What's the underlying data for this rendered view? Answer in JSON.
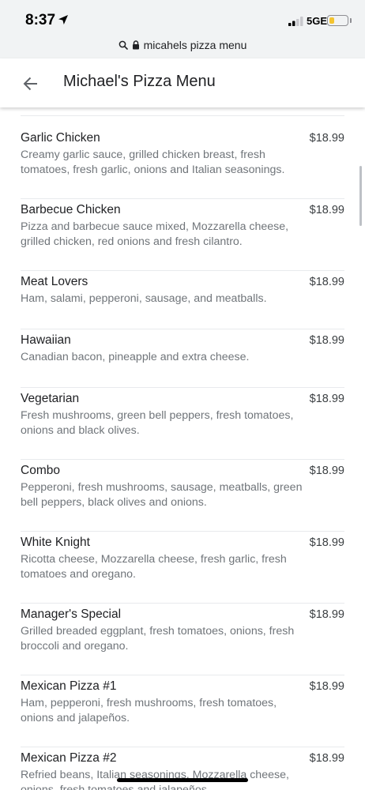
{
  "status_bar": {
    "time": "8:37",
    "network": "5GE",
    "battery_level": 0.3,
    "battery_color": "#f4c430"
  },
  "browser": {
    "url_text": "micahels pizza menu",
    "icons": [
      "search-icon",
      "lock-icon"
    ]
  },
  "header": {
    "title": "Michael's Pizza Menu",
    "back_icon": "arrow-left-icon"
  },
  "menu_items": [
    {
      "name": "Garlic Chicken",
      "price": "$18.99",
      "description": "Creamy garlic sauce, grilled chicken breast, fresh tomatoes, fresh garlic, onions and Italian seasonings."
    },
    {
      "name": "Barbecue Chicken",
      "price": "$18.99",
      "description": "Pizza and barbecue sauce mixed, Mozzarella cheese, grilled chicken, red onions and fresh cilantro."
    },
    {
      "name": "Meat Lovers",
      "price": "$18.99",
      "description": "Ham, salami, pepperoni, sausage, and meatballs."
    },
    {
      "name": "Hawaiian",
      "price": "$18.99",
      "description": "Canadian bacon, pineapple and extra cheese."
    },
    {
      "name": "Vegetarian",
      "price": "$18.99",
      "description": "Fresh mushrooms, green bell peppers, fresh tomatoes, onions and black olives."
    },
    {
      "name": "Combo",
      "price": "$18.99",
      "description": "Pepperoni, fresh mushrooms, sausage, meatballs, green bell peppers, black olives and onions."
    },
    {
      "name": "White Knight",
      "price": "$18.99",
      "description": "Ricotta cheese, Mozzarella cheese, fresh garlic, fresh tomatoes and oregano."
    },
    {
      "name": "Manager's Special",
      "price": "$18.99",
      "description": "Grilled breaded eggplant, fresh tomatoes, onions, fresh broccoli and oregano."
    },
    {
      "name": "Mexican Pizza #1",
      "price": "$18.99",
      "description": "Ham, pepperoni, fresh mushrooms, fresh tomatoes, onions and jalapeños."
    },
    {
      "name": "Mexican Pizza #2",
      "price": "$18.99",
      "description": "Refried beans, Italian seasonings, Mozzarella cheese, onions, fresh tomatoes and jalapeños."
    }
  ],
  "colors": {
    "chrome_bg": "#f1f3f4",
    "text_primary": "#202124",
    "text_secondary": "#70757a",
    "divider": "#e8eaed"
  }
}
